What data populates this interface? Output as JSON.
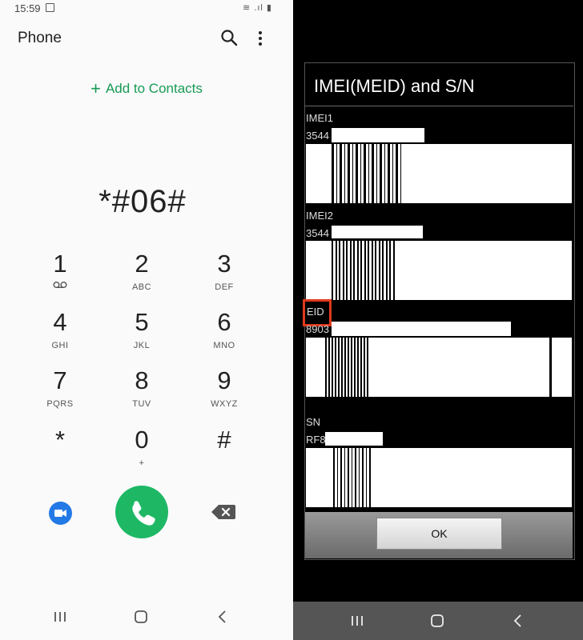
{
  "left": {
    "status": {
      "time": "15:59",
      "icons": "≋ .ıl ▮"
    },
    "title": "Phone",
    "add_contacts": "Add to Contacts",
    "dialed_number": "*#06#",
    "keys": [
      {
        "digit": "1",
        "letters": ""
      },
      {
        "digit": "2",
        "letters": "ABC"
      },
      {
        "digit": "3",
        "letters": "DEF"
      },
      {
        "digit": "4",
        "letters": "GHI"
      },
      {
        "digit": "5",
        "letters": "JKL"
      },
      {
        "digit": "6",
        "letters": "MNO"
      },
      {
        "digit": "7",
        "letters": "PQRS"
      },
      {
        "digit": "8",
        "letters": "TUV"
      },
      {
        "digit": "9",
        "letters": "WXYZ"
      },
      {
        "digit": "*",
        "letters": ""
      },
      {
        "digit": "0",
        "letters": "+"
      },
      {
        "digit": "#",
        "letters": ""
      }
    ],
    "colors": {
      "accent": "#179a55",
      "call": "#1eb865",
      "video": "#2379e6"
    }
  },
  "right": {
    "dialog_title": "IMEI(MEID) and S/N",
    "imei1_label": "IMEI1",
    "imei1_value": "3544",
    "imei2_label": "IMEI2",
    "imei2_value": "3544",
    "eid_label": "EID",
    "eid_value": "8903",
    "sn_label": "SN",
    "sn_value": "RF8",
    "ok_label": "OK",
    "highlight_color": "#e03a1e"
  }
}
